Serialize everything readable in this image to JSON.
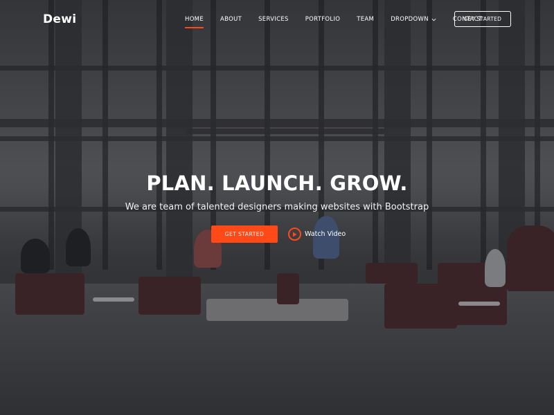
{
  "brand": {
    "name": "Dewi"
  },
  "nav": {
    "items": [
      {
        "label": "HOME",
        "active": true
      },
      {
        "label": "ABOUT",
        "active": false
      },
      {
        "label": "SERVICES",
        "active": false
      },
      {
        "label": "PORTFOLIO",
        "active": false
      },
      {
        "label": "TEAM",
        "active": false
      },
      {
        "label": "DROPDOWN",
        "active": false,
        "icon": "chevron-down-icon"
      },
      {
        "label": "CONTACT",
        "active": false
      }
    ],
    "cta_label": "GET STARTED"
  },
  "hero": {
    "title": "PLAN. LAUNCH. GROW.",
    "subtitle": "We are team of talented designers making websites with Bootstrap",
    "primary_button": "GET STARTED",
    "video_label": "Watch Video",
    "video_icon": "play-circle-icon"
  },
  "colors": {
    "accent": "#ff4a17",
    "text": "#ffffff"
  }
}
